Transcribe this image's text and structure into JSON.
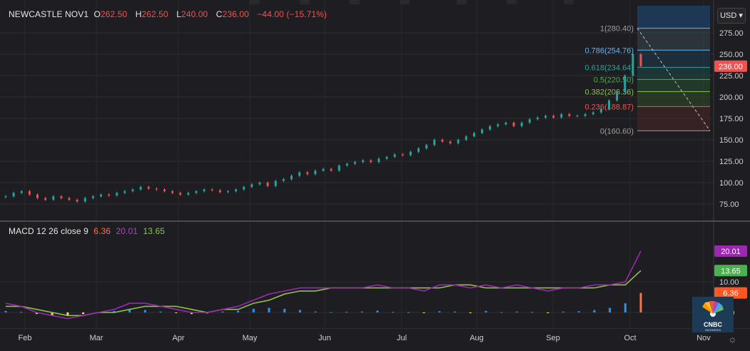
{
  "legend": {
    "symbol": "NEWCASTLE NOV1",
    "open_label": "O",
    "open": "262.50",
    "high_label": "H",
    "high": "262.50",
    "low_label": "L",
    "low": "240.00",
    "close_label": "C",
    "close": "236.00",
    "change": "−44.00 (−15.71%)"
  },
  "currency_button": "USD",
  "macd_legend": {
    "name": "MACD 12 26 close 9",
    "histogram": "6.36",
    "macd": "20.01",
    "signal": "13.65"
  },
  "price_axis": {
    "ticks": [
      "275.00",
      "250.00",
      "225.00",
      "200.00",
      "175.00",
      "150.00",
      "125.00",
      "100.00",
      "75.00"
    ],
    "last_price": "236.00"
  },
  "macd_axis": {
    "ticks": [
      "10.00",
      "0.00"
    ],
    "badges": [
      "20.01",
      "13.65",
      "6.36"
    ]
  },
  "time_axis": {
    "labels": [
      "Feb",
      "Mar",
      "Apr",
      "May",
      "Jun",
      "Jul",
      "Aug",
      "Sep",
      "Oct",
      "Nov"
    ]
  },
  "fibonacci": {
    "levels": [
      {
        "label": "1(280.40)",
        "ratio": 1,
        "price": 280.4,
        "color": "#9e9e9e"
      },
      {
        "label": "0.786(254.76)",
        "ratio": 0.786,
        "price": 254.76,
        "color": "#64b5f6"
      },
      {
        "label": "0.618(234.64)",
        "ratio": 0.618,
        "price": 234.64,
        "color": "#26a69a"
      },
      {
        "label": "0.5(220.50)",
        "ratio": 0.5,
        "price": 220.5,
        "color": "#4caf50"
      },
      {
        "label": "0.382(206.36)",
        "ratio": 0.382,
        "price": 206.36,
        "color": "#8bc34a"
      },
      {
        "label": "0.236(188.87)",
        "ratio": 0.236,
        "price": 188.87,
        "color": "#ef5350"
      },
      {
        "label": "0(160.60)",
        "ratio": 0,
        "price": 160.6,
        "color": "#9e9e9e"
      }
    ]
  },
  "colors": {
    "up": "#26a69a",
    "down": "#ef5350",
    "macd": "#9c27b0",
    "signal": "#8bc34a",
    "hist_pos": "#2196f3",
    "hist_neg": "#ffeb3b",
    "background": "#1e1e22"
  },
  "watermark": {
    "brand": "CNBC",
    "sub": "INDONESIA"
  },
  "chart_data": [
    {
      "type": "candlestick",
      "title": "NEWCASTLE NOV1",
      "ylim": [
        60,
        290
      ],
      "x_range": [
        "Jan 2021",
        "Nov 2021"
      ],
      "series": [
        {
          "name": "NEWCASTLE NOV1",
          "close": [
            84,
            88,
            90,
            86,
            82,
            80,
            84,
            82,
            80,
            78,
            82,
            84,
            86,
            85,
            88,
            90,
            92,
            95,
            93,
            92,
            90,
            88,
            86,
            88,
            90,
            92,
            91,
            89,
            90,
            92,
            95,
            98,
            100,
            96,
            102,
            104,
            108,
            112,
            110,
            114,
            116,
            114,
            120,
            122,
            124,
            126,
            124,
            128,
            130,
            133,
            132,
            136,
            140,
            144,
            150,
            148,
            146,
            150,
            154,
            158,
            162,
            166,
            168,
            170,
            166,
            170,
            174,
            176,
            178,
            176,
            180,
            178,
            178,
            180,
            182,
            186,
            196,
            206,
            225,
            250,
            236
          ]
        }
      ]
    },
    {
      "type": "line",
      "title": "MACD 12 26 close 9",
      "ylim": [
        -5,
        25
      ],
      "series": [
        {
          "name": "MACD",
          "values": [
            3,
            2,
            0,
            -1,
            -2,
            -1,
            0,
            1,
            3,
            3,
            2,
            1,
            0,
            0,
            1,
            2,
            4,
            6,
            7,
            8,
            8,
            8,
            8,
            8,
            9,
            8,
            8,
            7,
            9,
            9,
            8,
            9,
            8,
            9,
            8,
            7,
            8,
            8,
            9,
            9,
            10,
            20.01
          ]
        },
        {
          "name": "Signal",
          "values": [
            2,
            2,
            1,
            0,
            -1,
            -1,
            0,
            0,
            1,
            2,
            2,
            2,
            1,
            0,
            1,
            1,
            3,
            4,
            6,
            7,
            7,
            8,
            8,
            8,
            8,
            8,
            8,
            8,
            8,
            9,
            9,
            8,
            8,
            8,
            8,
            8,
            8,
            8,
            8,
            9,
            9,
            13.65
          ]
        },
        {
          "name": "Histogram",
          "values": [
            0.5,
            0.2,
            -0.5,
            -1,
            -1,
            -0.5,
            0,
            0.5,
            1,
            0.8,
            0.3,
            -0.2,
            -0.5,
            -0.3,
            0.3,
            0.6,
            1.2,
            1.5,
            1.2,
            0.8,
            0.3,
            0.1,
            0.2,
            0.3,
            0.6,
            0.2,
            0.1,
            -0.2,
            0.4,
            0.3,
            -0.1,
            0.5,
            0.1,
            0.3,
            0.2,
            -0.2,
            0.3,
            0.4,
            0.8,
            1.5,
            3.0,
            6.36
          ]
        }
      ]
    }
  ]
}
